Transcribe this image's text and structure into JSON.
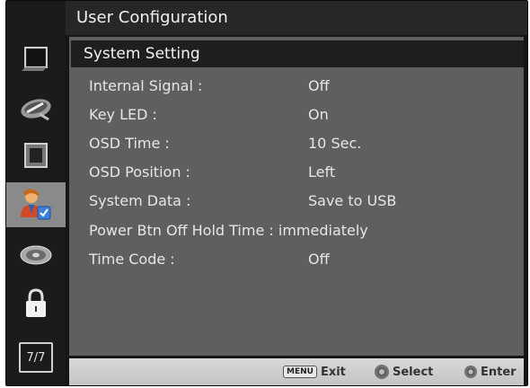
{
  "header": {
    "title": "User Configuration"
  },
  "section": {
    "title": "System Setting"
  },
  "settings": [
    {
      "label": "Internal Signal :",
      "value": "Off"
    },
    {
      "label": "Key LED :",
      "value": "On"
    },
    {
      "label": "OSD Time :",
      "value": "10 Sec."
    },
    {
      "label": "OSD Position :",
      "value": "Left"
    },
    {
      "label": "System Data :",
      "value": "Save to USB"
    },
    {
      "label": "Power Btn Off Hold Time :",
      "value": "immediately"
    },
    {
      "label": "Time Code :",
      "value": "Off"
    }
  ],
  "sidebar": {
    "items": [
      {
        "icon": "monitor-icon"
      },
      {
        "icon": "satellite-dish-icon"
      },
      {
        "icon": "picture-frame-icon"
      },
      {
        "icon": "user-config-icon",
        "active": true
      },
      {
        "icon": "disc-icon"
      },
      {
        "icon": "lock-icon"
      },
      {
        "icon": "page-indicator-icon",
        "label": "7/7"
      }
    ]
  },
  "footer": {
    "menu_key": "MENU",
    "exit_label": "Exit",
    "select_label": "Select",
    "enter_label": "Enter"
  },
  "colors": {
    "panel": "#5f5f5f",
    "active_tab": "#8a8a8a",
    "section_bar": "#1e1e1e"
  }
}
